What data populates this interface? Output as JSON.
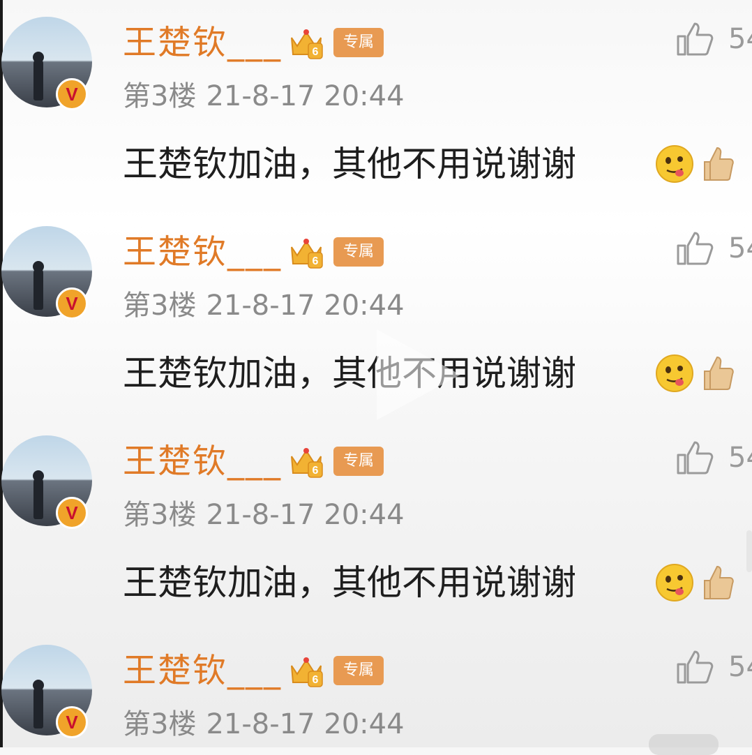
{
  "comments": [
    {
      "username": "王楚钦___",
      "exclusive_badge": "专属",
      "level_badge": "6",
      "like_count": "54",
      "floor": "第3楼",
      "timestamp": "21-8-17 20:44",
      "text": "王楚钦加油，其他不用说谢谢",
      "verified_badge": "V",
      "icons": [
        "crown-level-icon",
        "like-thumb-icon",
        "tongue-out-emoji",
        "thumbs-up-emoji"
      ]
    },
    {
      "username": "王楚钦___",
      "exclusive_badge": "专属",
      "level_badge": "6",
      "like_count": "54",
      "floor": "第3楼",
      "timestamp": "21-8-17 20:44",
      "text": "王楚钦加油，其他不用说谢谢",
      "verified_badge": "V",
      "icons": [
        "crown-level-icon",
        "like-thumb-icon",
        "tongue-out-emoji",
        "thumbs-up-emoji"
      ]
    },
    {
      "username": "王楚钦___",
      "exclusive_badge": "专属",
      "level_badge": "6",
      "like_count": "54",
      "floor": "第3楼",
      "timestamp": "21-8-17 20:44",
      "text": "王楚钦加油，其他不用说谢谢",
      "verified_badge": "V",
      "icons": [
        "crown-level-icon",
        "like-thumb-icon",
        "tongue-out-emoji",
        "thumbs-up-emoji"
      ]
    },
    {
      "username": "王楚钦___",
      "exclusive_badge": "专属",
      "level_badge": "6",
      "like_count": "54",
      "floor": "第3楼",
      "timestamp": "21-8-17 20:44",
      "verified_badge": "V",
      "icons": [
        "crown-level-icon",
        "like-thumb-icon"
      ]
    }
  ],
  "overlay": {
    "icon": "play-icon"
  },
  "colors": {
    "username": "#e07a27",
    "badge": "#e89a52",
    "meta": "#8a8a8a",
    "body_text": "#1e1e1e"
  }
}
